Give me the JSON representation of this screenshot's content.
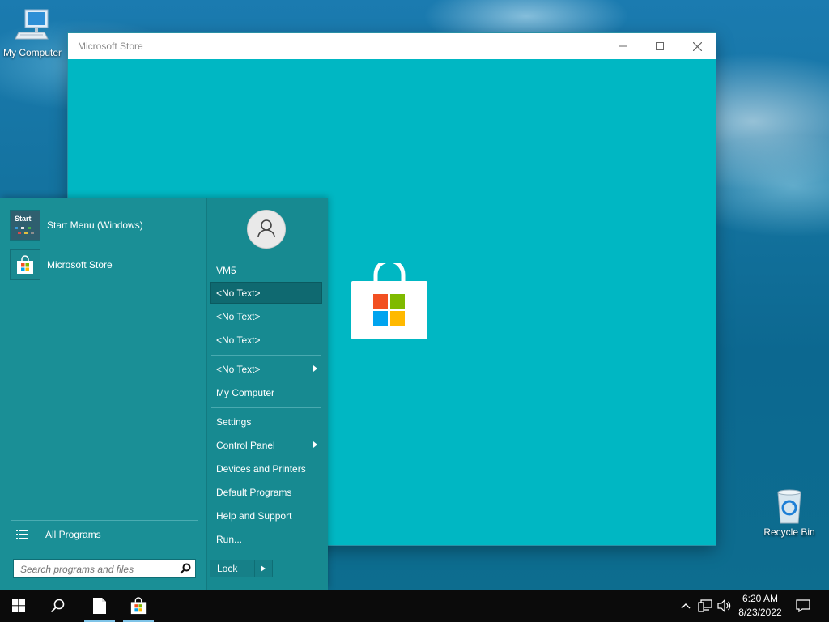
{
  "desktop": {
    "icons": [
      {
        "label": "My Computer"
      },
      {
        "label": "Recycle Bin"
      }
    ]
  },
  "window": {
    "title": "Microsoft Store",
    "bg_color": "#00b7c3",
    "controls": {
      "minimize": "minimize-icon",
      "maximize": "maximize-icon",
      "close": "close-icon"
    }
  },
  "start_menu": {
    "pinned": [
      {
        "label": "Start Menu (Windows)",
        "icon_text": "Start"
      },
      {
        "label": "Microsoft Store"
      }
    ],
    "all_programs": "All Programs",
    "search_placeholder": "Search programs and files",
    "user": "VM5",
    "right_items": [
      {
        "label": "<No Text>",
        "highlighted": true
      },
      {
        "label": "<No Text>"
      },
      {
        "label": "<No Text>"
      },
      {
        "label": "<No Text>",
        "submenu": true
      },
      {
        "label": "My Computer"
      },
      {
        "label": "Settings"
      },
      {
        "label": "Control Panel",
        "submenu": true
      },
      {
        "label": "Devices and Printers"
      },
      {
        "label": "Default Programs"
      },
      {
        "label": "Help and Support"
      },
      {
        "label": "Run..."
      }
    ],
    "lock_label": "Lock"
  },
  "taskbar": {
    "time": "6:20 AM",
    "date": "8/23/2022",
    "accent": "#7fc4e8"
  }
}
